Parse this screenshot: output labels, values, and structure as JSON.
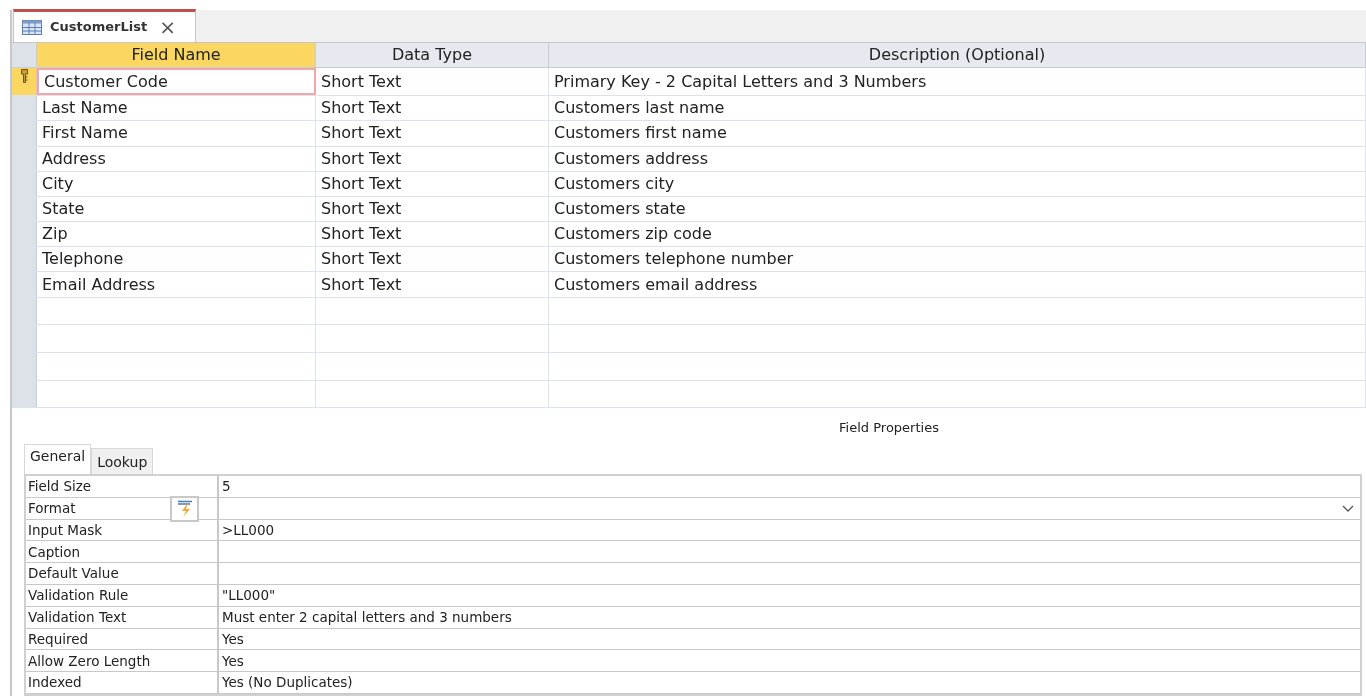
{
  "document_tab": {
    "title": "CustomerList",
    "close": "×"
  },
  "columns": [
    {
      "label": "Field Name",
      "selected": true
    },
    {
      "label": "Data Type",
      "selected": false
    },
    {
      "label": "Description (Optional)",
      "selected": false
    }
  ],
  "fields": [
    {
      "name": "Customer Code",
      "type": "Short Text",
      "description": "Primary Key - 2 Capital Letters and 3 Numbers",
      "selected": true,
      "primary_key": true
    },
    {
      "name": "Last Name",
      "type": "Short Text",
      "description": "Customers last name",
      "selected": false,
      "primary_key": false
    },
    {
      "name": "First Name",
      "type": "Short Text",
      "description": "Customers first name",
      "selected": false,
      "primary_key": false
    },
    {
      "name": "Address",
      "type": "Short Text",
      "description": "Customers address",
      "selected": false,
      "primary_key": false
    },
    {
      "name": "City",
      "type": "Short Text",
      "description": "Customers city",
      "selected": false,
      "primary_key": false
    },
    {
      "name": "State",
      "type": "Short Text",
      "description": "Customers state",
      "selected": false,
      "primary_key": false
    },
    {
      "name": "Zip",
      "type": "Short Text",
      "description": "Customers zip code",
      "selected": false,
      "primary_key": false
    },
    {
      "name": "Telephone",
      "type": "Short Text",
      "description": "Customers telephone number",
      "selected": false,
      "primary_key": false
    },
    {
      "name": "Email Address",
      "type": "Short Text",
      "description": "Customers email address",
      "selected": false,
      "primary_key": false
    }
  ],
  "field_properties": {
    "title": "Field Properties",
    "tabs": [
      {
        "label": "General",
        "selected": true
      },
      {
        "label": "Lookup",
        "selected": false
      }
    ],
    "properties": [
      {
        "label": "Field Size",
        "value": "5",
        "focused": false
      },
      {
        "label": "Format",
        "focused": true
      },
      {
        "label": "Input Mask",
        "value": ">LL000",
        "focused": false
      },
      {
        "label": "Caption",
        "focused": false
      },
      {
        "label": "Default Value",
        "focused": false
      },
      {
        "label": "Validation Rule",
        "value": "\"LL000\"",
        "focused": false
      },
      {
        "label": "Validation Text",
        "value": "Must enter 2 capital letters and 3 numbers",
        "focused": false
      },
      {
        "label": "Required",
        "value": "Yes",
        "focused": false
      },
      {
        "label": "Allow Zero Length",
        "value": "Yes",
        "focused": false
      },
      {
        "label": "Indexed",
        "value": "Yes (No Duplicates)",
        "focused": false
      }
    ]
  }
}
